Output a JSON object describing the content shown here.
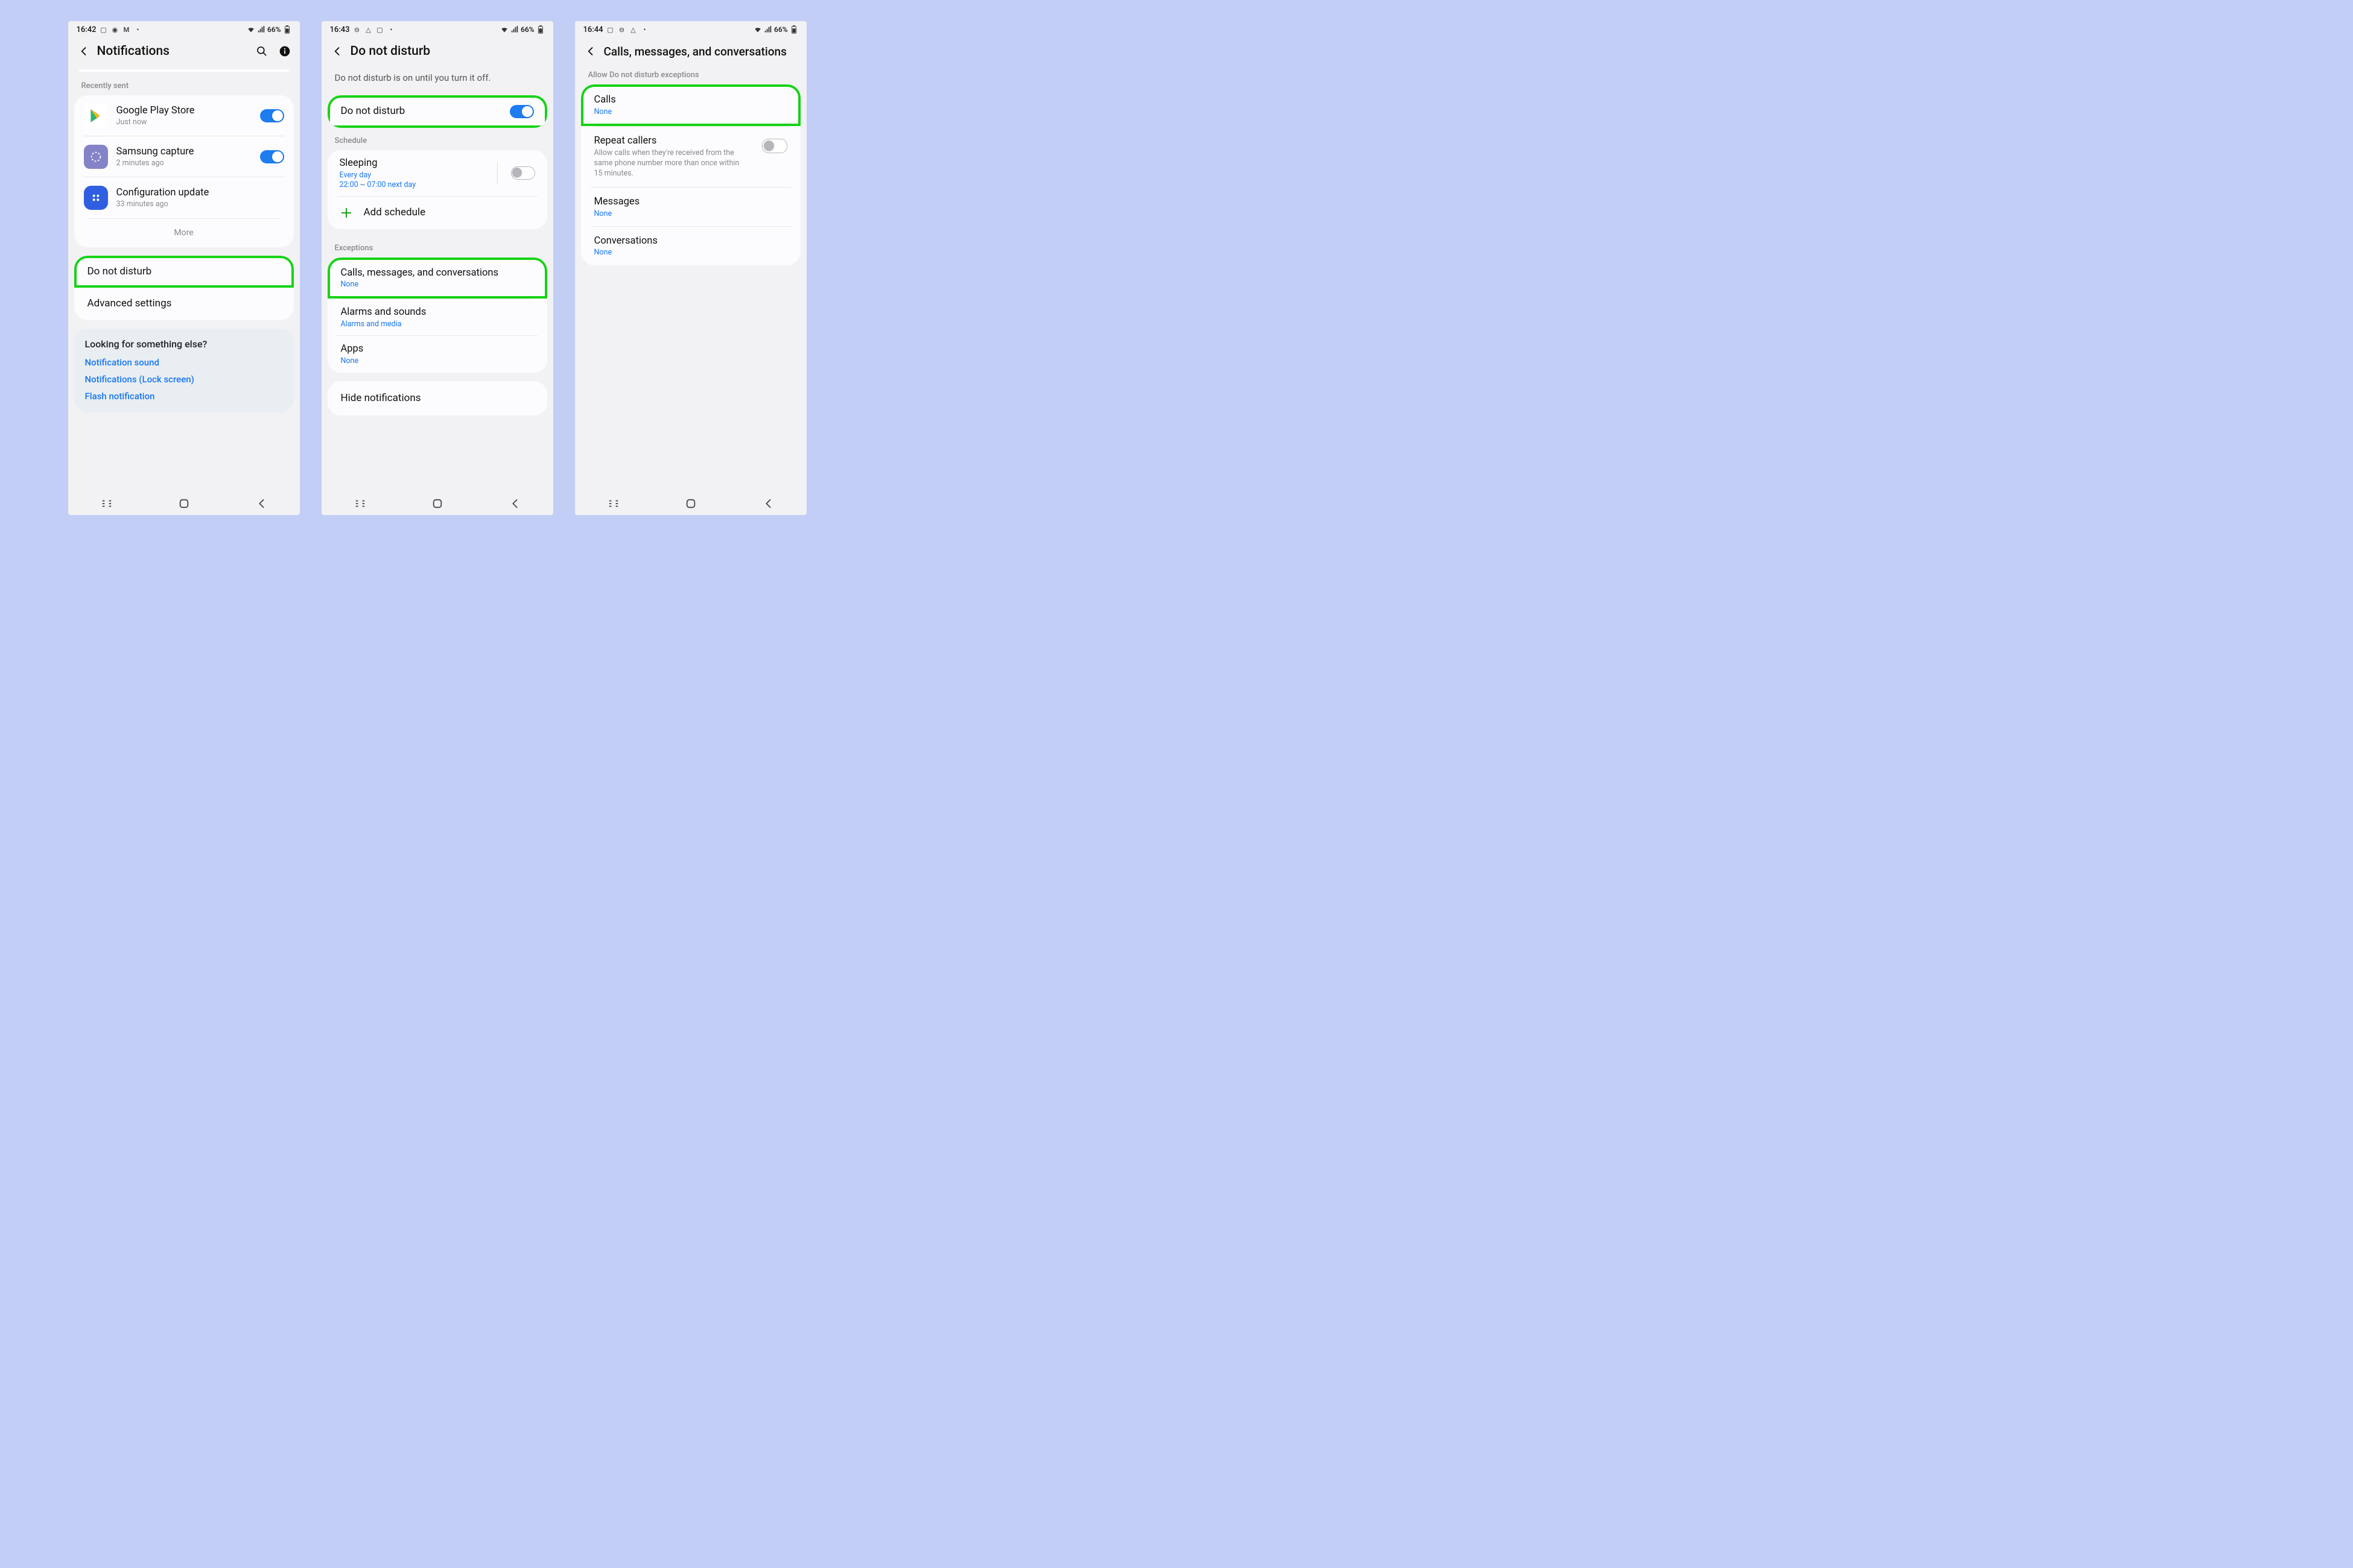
{
  "phone1": {
    "status": {
      "time": "16:42",
      "battery": "66%"
    },
    "header": {
      "title": "Notifications"
    },
    "recently_label": "Recently sent",
    "apps": [
      {
        "name": "Google Play Store",
        "sub": "Just now",
        "toggle": true
      },
      {
        "name": "Samsung capture",
        "sub": "2 minutes ago",
        "toggle": true
      },
      {
        "name": "Configuration update",
        "sub": "33 minutes ago",
        "toggle": null
      }
    ],
    "more": "More",
    "dnd": "Do not disturb",
    "advanced": "Advanced settings",
    "looking": {
      "title": "Looking for something else?",
      "links": [
        "Notification sound",
        "Notifications (Lock screen)",
        "Flash notification"
      ]
    }
  },
  "phone2": {
    "status": {
      "time": "16:43",
      "battery": "66%"
    },
    "header": {
      "title": "Do not disturb"
    },
    "info_text": "Do not disturb is on until you turn it off.",
    "dnd_row": "Do not disturb",
    "schedule_label": "Schedule",
    "sleeping": {
      "title": "Sleeping",
      "sub1": "Every day",
      "sub2": "22:00 ~ 07:00 next day"
    },
    "add_schedule": "Add schedule",
    "exceptions_label": "Exceptions",
    "calls_row": {
      "title": "Calls, messages, and conversations",
      "sub": "None"
    },
    "alarms_row": {
      "title": "Alarms and sounds",
      "sub": "Alarms and media"
    },
    "apps_row": {
      "title": "Apps",
      "sub": "None"
    },
    "hide_notifications": "Hide notifications"
  },
  "phone3": {
    "status": {
      "time": "16:44",
      "battery": "66%"
    },
    "header": {
      "title": "Calls, messages, and conversations"
    },
    "section_label": "Allow Do not disturb exceptions",
    "calls": {
      "title": "Calls",
      "sub": "None"
    },
    "repeat": {
      "title": "Repeat callers",
      "desc": "Allow calls when they're received from the same phone number more than once within 15 minutes."
    },
    "messages": {
      "title": "Messages",
      "sub": "None"
    },
    "conversations": {
      "title": "Conversations",
      "sub": "None"
    }
  }
}
